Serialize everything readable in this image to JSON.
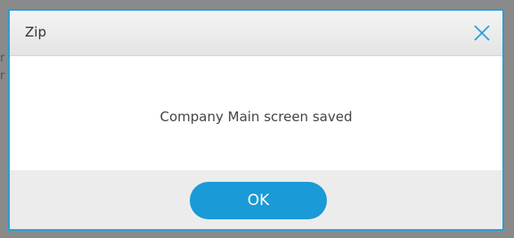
{
  "dialog": {
    "title": "Zip",
    "message": "Company Main screen saved",
    "ok_label": "OK",
    "close_icon": "close-icon"
  },
  "backdrop": {
    "fragment_1": "r",
    "fragment_2": "r"
  },
  "colors": {
    "accent": "#1a9ad6",
    "border": "#2a9fd6",
    "footer_bg": "#ececec",
    "overlay": "#8a8a8a"
  }
}
